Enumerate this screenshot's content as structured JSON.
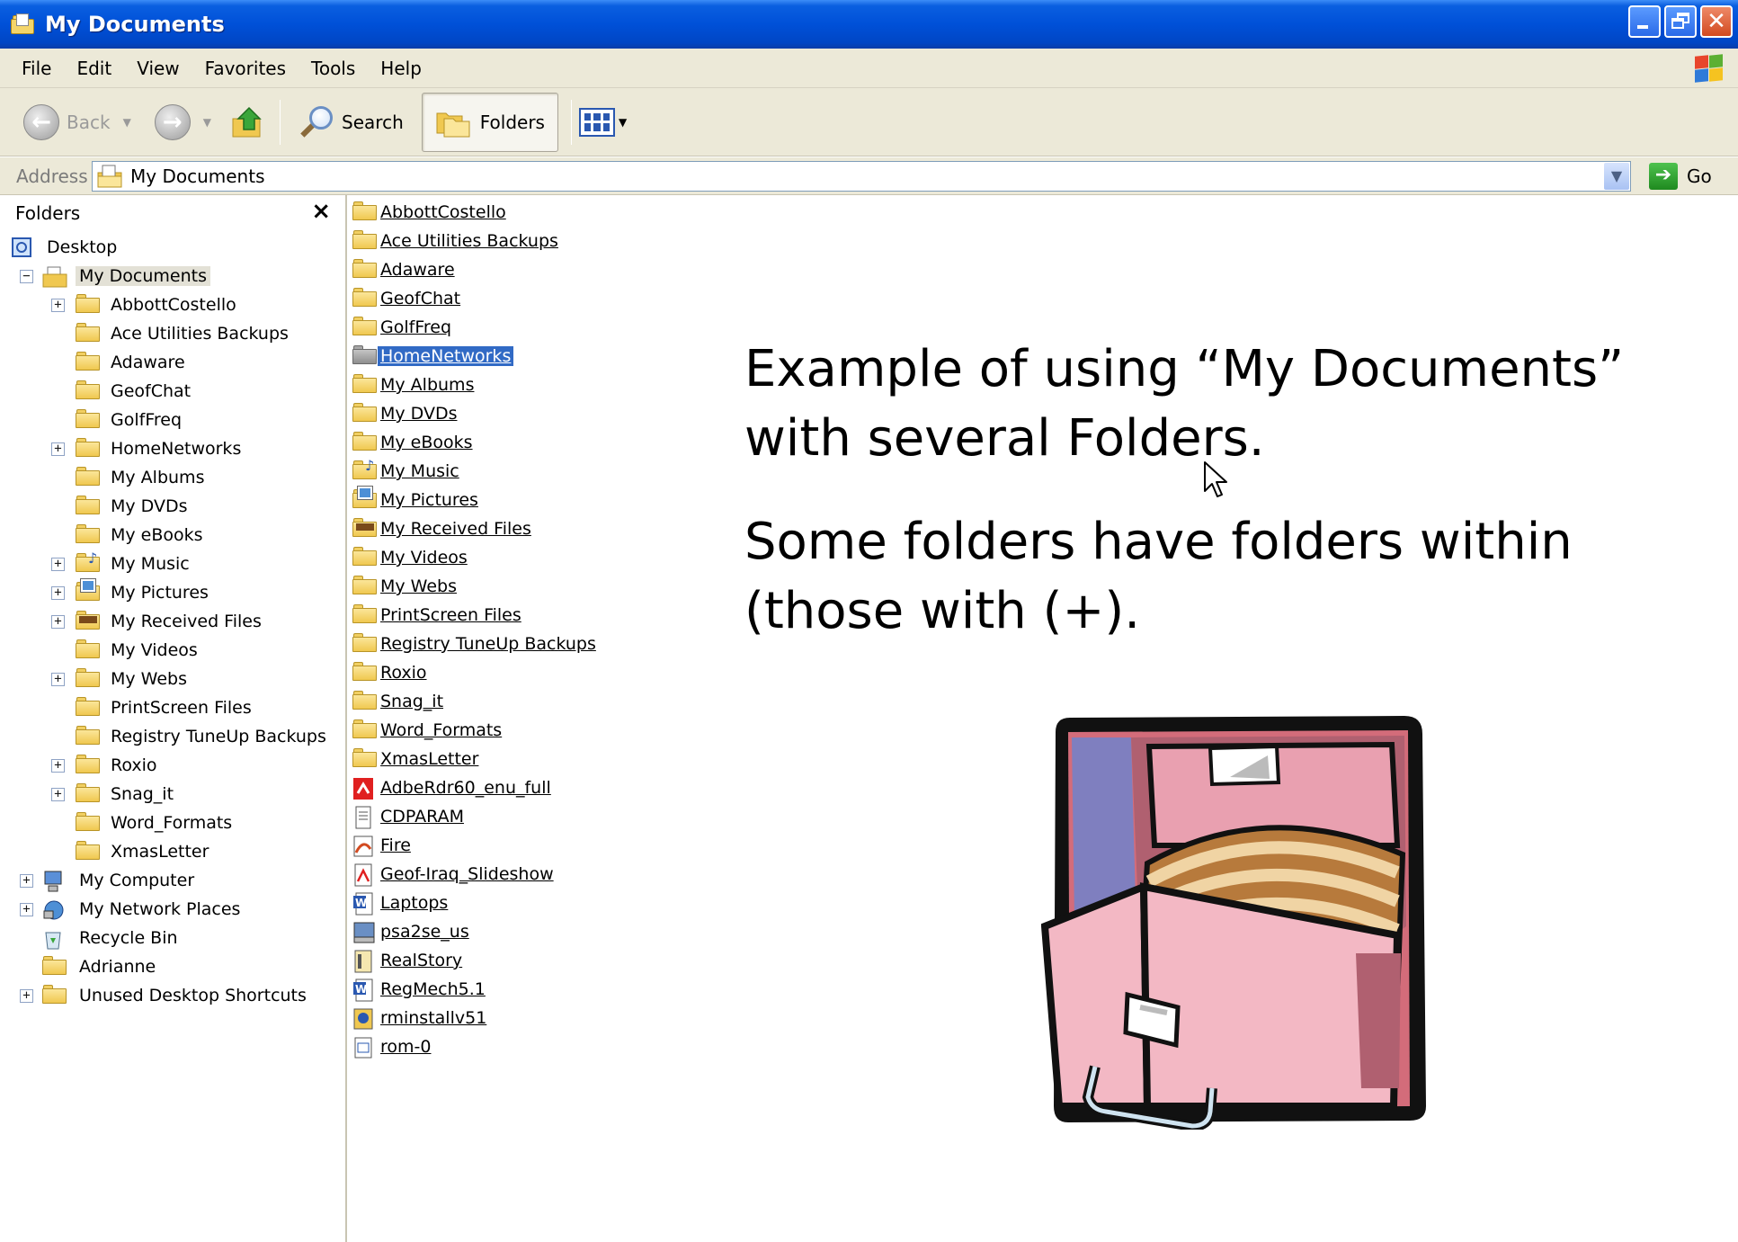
{
  "window": {
    "title": "My Documents"
  },
  "menu": [
    "File",
    "Edit",
    "View",
    "Favorites",
    "Tools",
    "Help"
  ],
  "toolbar": {
    "back_label": "Back",
    "search_label": "Search",
    "folders_label": "Folders"
  },
  "address": {
    "label": "Address",
    "value": "My Documents",
    "go_label": "Go"
  },
  "folders_pane": {
    "title": "Folders",
    "close": "×",
    "tree": [
      {
        "label": "Desktop",
        "level": 0,
        "icon": "desktop-icon",
        "expander": ""
      },
      {
        "label": "My Documents",
        "level": 1,
        "icon": "my-documents-icon",
        "expander": "−",
        "selected": true
      },
      {
        "label": "AbbottCostello",
        "level": 2,
        "icon": "folder-icon",
        "expander": "+"
      },
      {
        "label": "Ace Utilities Backups",
        "level": 2,
        "icon": "folder-icon",
        "expander": ""
      },
      {
        "label": "Adaware",
        "level": 2,
        "icon": "folder-icon",
        "expander": ""
      },
      {
        "label": "GeofChat",
        "level": 2,
        "icon": "folder-icon",
        "expander": ""
      },
      {
        "label": "GolfFreq",
        "level": 2,
        "icon": "folder-icon",
        "expander": ""
      },
      {
        "label": "HomeNetworks",
        "level": 2,
        "icon": "folder-icon",
        "expander": "+"
      },
      {
        "label": "My Albums",
        "level": 2,
        "icon": "folder-icon",
        "expander": ""
      },
      {
        "label": "My DVDs",
        "level": 2,
        "icon": "folder-icon",
        "expander": ""
      },
      {
        "label": "My eBooks",
        "level": 2,
        "icon": "folder-icon",
        "expander": ""
      },
      {
        "label": "My Music",
        "level": 2,
        "icon": "music-folder-icon",
        "expander": "+"
      },
      {
        "label": "My Pictures",
        "level": 2,
        "icon": "pictures-folder-icon",
        "expander": "+"
      },
      {
        "label": "My Received Files",
        "level": 2,
        "icon": "received-folder-icon",
        "expander": "+"
      },
      {
        "label": "My Videos",
        "level": 2,
        "icon": "folder-icon",
        "expander": ""
      },
      {
        "label": "My Webs",
        "level": 2,
        "icon": "folder-icon",
        "expander": "+"
      },
      {
        "label": "PrintScreen Files",
        "level": 2,
        "icon": "folder-icon",
        "expander": ""
      },
      {
        "label": "Registry TuneUp Backups",
        "level": 2,
        "icon": "folder-icon",
        "expander": ""
      },
      {
        "label": "Roxio",
        "level": 2,
        "icon": "folder-icon",
        "expander": "+"
      },
      {
        "label": "Snag_it",
        "level": 2,
        "icon": "folder-icon",
        "expander": "+"
      },
      {
        "label": "Word_Formats",
        "level": 2,
        "icon": "folder-icon",
        "expander": ""
      },
      {
        "label": "XmasLetter",
        "level": 2,
        "icon": "folder-icon",
        "expander": ""
      },
      {
        "label": "My Computer",
        "level": 1,
        "icon": "my-computer-icon",
        "expander": "+"
      },
      {
        "label": "My Network Places",
        "level": 1,
        "icon": "network-places-icon",
        "expander": "+"
      },
      {
        "label": "Recycle Bin",
        "level": 1,
        "icon": "recycle-bin-icon",
        "expander": ""
      },
      {
        "label": "Adrianne",
        "level": 1,
        "icon": "folder-icon",
        "expander": ""
      },
      {
        "label": "Unused Desktop Shortcuts",
        "level": 1,
        "icon": "folder-icon",
        "expander": "+"
      }
    ]
  },
  "file_list": [
    {
      "label": "AbbottCostello",
      "icon": "folder-icon"
    },
    {
      "label": "Ace Utilities Backups",
      "icon": "folder-icon"
    },
    {
      "label": "Adaware",
      "icon": "folder-icon"
    },
    {
      "label": "GeofChat",
      "icon": "folder-icon"
    },
    {
      "label": "GolfFreq",
      "icon": "folder-icon"
    },
    {
      "label": "HomeNetworks",
      "icon": "folder-icon",
      "selected": true
    },
    {
      "label": "My Albums",
      "icon": "folder-icon"
    },
    {
      "label": "My DVDs",
      "icon": "folder-icon"
    },
    {
      "label": "My eBooks",
      "icon": "folder-icon"
    },
    {
      "label": "My Music",
      "icon": "music-folder-icon"
    },
    {
      "label": "My Pictures",
      "icon": "pictures-folder-icon"
    },
    {
      "label": "My Received Files",
      "icon": "received-folder-icon"
    },
    {
      "label": "My Videos",
      "icon": "folder-icon"
    },
    {
      "label": "My Webs",
      "icon": "folder-icon"
    },
    {
      "label": "PrintScreen Files",
      "icon": "folder-icon"
    },
    {
      "label": "Registry TuneUp Backups",
      "icon": "folder-icon"
    },
    {
      "label": "Roxio",
      "icon": "folder-icon"
    },
    {
      "label": "Snag_it",
      "icon": "folder-icon"
    },
    {
      "label": "Word_Formats",
      "icon": "folder-icon"
    },
    {
      "label": "XmasLetter",
      "icon": "folder-icon"
    },
    {
      "label": "AdbeRdr60_enu_full",
      "icon": "adobe-reader-icon"
    },
    {
      "label": "CDPARAM",
      "icon": "text-file-icon"
    },
    {
      "label": "Fire",
      "icon": "image-file-icon"
    },
    {
      "label": "Geof-Iraq_Slideshow",
      "icon": "pdf-file-icon"
    },
    {
      "label": "Laptops",
      "icon": "word-doc-icon"
    },
    {
      "label": "psa2se_us",
      "icon": "installer-icon"
    },
    {
      "label": "RealStory",
      "icon": "document-icon"
    },
    {
      "label": "RegMech5.1",
      "icon": "word-doc-icon"
    },
    {
      "label": "rminstallv51",
      "icon": "setup-icon"
    },
    {
      "label": "rom-0",
      "icon": "binary-file-icon"
    }
  ],
  "caption": {
    "line1": "Example of using “My Documents” with several Folders.",
    "line2": "Some folders have folders within (those with (+)."
  },
  "colors": {
    "titlebar": "#0050d8",
    "chrome": "#ece9d8",
    "selection": "#316ac5"
  }
}
